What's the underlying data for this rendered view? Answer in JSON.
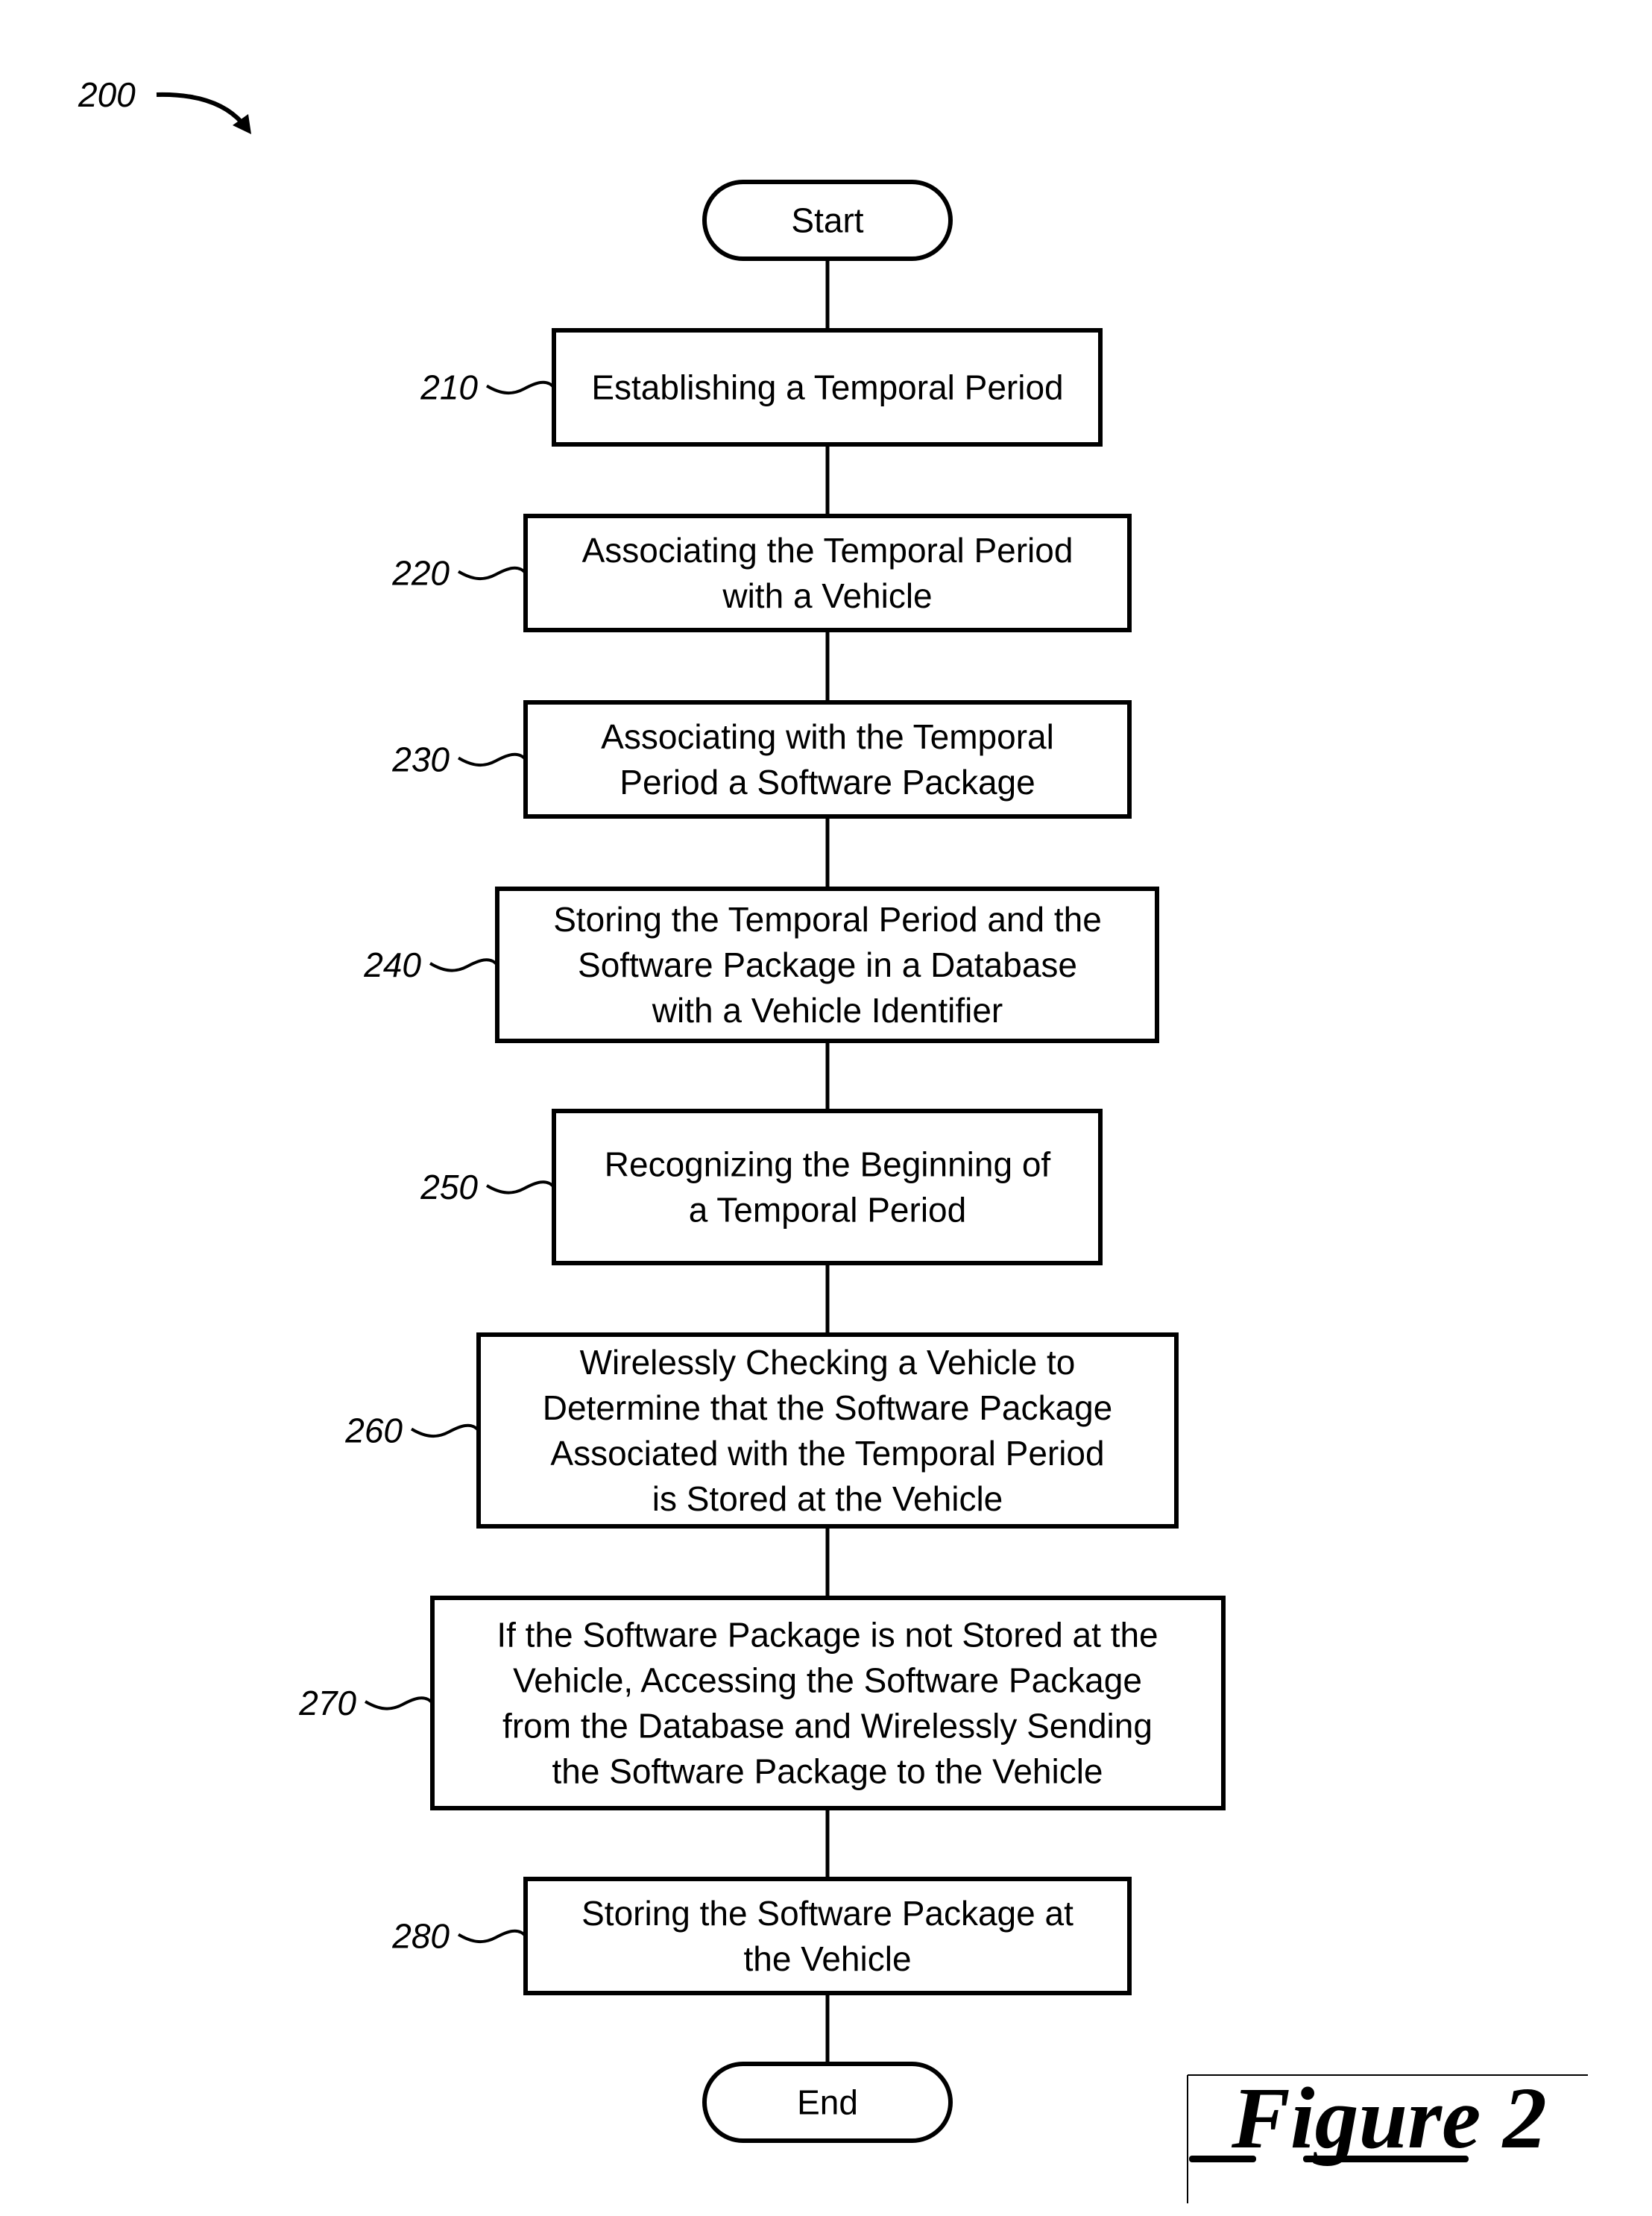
{
  "figure": {
    "reference_number": "200",
    "caption": "Figure 2"
  },
  "flowchart": {
    "start": {
      "label": "Start"
    },
    "end": {
      "label": "End"
    },
    "steps": [
      {
        "ref": "210",
        "lines": [
          "Establishing a Temporal Period"
        ]
      },
      {
        "ref": "220",
        "lines": [
          "Associating the Temporal Period",
          "with a Vehicle"
        ]
      },
      {
        "ref": "230",
        "lines": [
          "Associating with the Temporal",
          "Period a Software Package"
        ]
      },
      {
        "ref": "240",
        "lines": [
          "Storing the Temporal Period and the",
          "Software Package in a Database",
          "with a Vehicle Identifier"
        ]
      },
      {
        "ref": "250",
        "lines": [
          "Recognizing the Beginning of",
          "a Temporal Period"
        ]
      },
      {
        "ref": "260",
        "lines": [
          "Wirelessly Checking a Vehicle to",
          "Determine that the Software Package",
          "Associated with the Temporal Period",
          "is Stored at the Vehicle"
        ]
      },
      {
        "ref": "270",
        "lines": [
          "If the Software Package is not Stored at the",
          "Vehicle, Accessing the Software Package",
          "from the Database and Wirelessly Sending",
          "the Software Package to the Vehicle"
        ]
      },
      {
        "ref": "280",
        "lines": [
          "Storing the Software Package at",
          "the Vehicle"
        ]
      }
    ]
  }
}
